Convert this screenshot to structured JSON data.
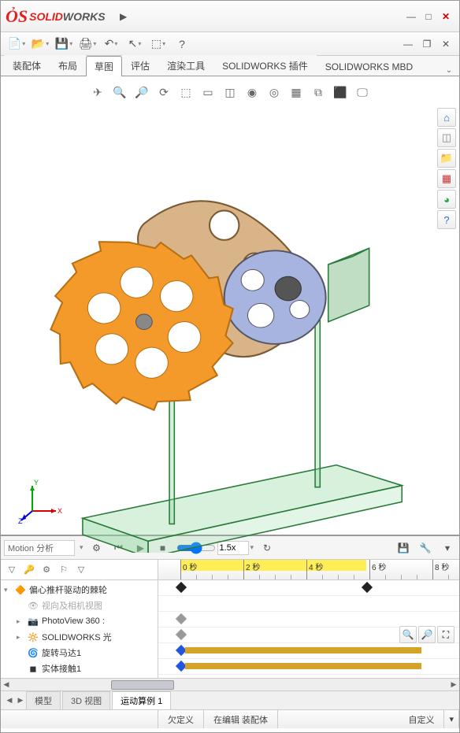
{
  "app": {
    "logo_solid": "SOLID",
    "logo_works": "WORKS"
  },
  "titlebar_tools": [
    "▶"
  ],
  "window_controls": {
    "min": "—",
    "max": "□",
    "close": "✕"
  },
  "ribbon": {
    "tabs": [
      "装配体",
      "布局",
      "草图",
      "评估",
      "渲染工具",
      "SOLIDWORKS 插件",
      "SOLIDWORKS MBD"
    ],
    "active_index": 2
  },
  "headsup_icons": [
    "✈",
    "🔍",
    "🔎",
    "⟳",
    "⬚",
    "▭",
    "◫",
    "◉",
    "◎",
    "▦",
    "⧉",
    "⬛",
    "🖵"
  ],
  "right_rail": [
    {
      "name": "home-icon",
      "glyph": "⌂",
      "color": "#2a6bcc"
    },
    {
      "name": "view-icon",
      "glyph": "◫",
      "color": "#888"
    },
    {
      "name": "folder-icon",
      "glyph": "📁",
      "color": "#caa12a"
    },
    {
      "name": "grid-icon",
      "glyph": "▦",
      "color": "#cc3333"
    },
    {
      "name": "palette-icon",
      "glyph": "◕",
      "color": "#22aa44"
    },
    {
      "name": "help-icon",
      "glyph": "?",
      "color": "#2a6bcc"
    }
  ],
  "triad": {
    "x": "X",
    "y": "Y",
    "z": "Z"
  },
  "motion": {
    "selector": "Motion 分析",
    "speed": "1.5x",
    "tree_header_icons": [
      "▽",
      "🔑",
      "⚙",
      "⚐",
      "▽"
    ],
    "tree": [
      {
        "exp": "▾",
        "ico": "🔶",
        "name": "assembly-root",
        "label": "偏心推杆驱动的棘轮",
        "disabled": false,
        "indent": 0
      },
      {
        "exp": "",
        "ico": "👁",
        "name": "view-camera",
        "label": "视向及相机视图",
        "disabled": true,
        "indent": 1
      },
      {
        "exp": "▸",
        "ico": "📷",
        "name": "photoview",
        "label": "PhotoView 360 :",
        "disabled": false,
        "indent": 1
      },
      {
        "exp": "▸",
        "ico": "🔆",
        "name": "sw-lights",
        "label": "SOLIDWORKS 光",
        "disabled": false,
        "indent": 1
      },
      {
        "exp": "",
        "ico": "🌀",
        "name": "rotary-motor",
        "label": "旋转马达1",
        "disabled": false,
        "indent": 1
      },
      {
        "exp": "",
        "ico": "◼",
        "name": "solid-contact",
        "label": "实体接触1",
        "disabled": false,
        "indent": 1
      }
    ],
    "timeline": {
      "ticks": [
        {
          "pos": 28,
          "label": "0 秒",
          "sub": false
        },
        {
          "pos": 108,
          "label": "2 秒",
          "sub": false
        },
        {
          "pos": 188,
          "label": "4 秒",
          "sub": false
        },
        {
          "pos": 268,
          "label": "6 秒",
          "sub": false
        },
        {
          "pos": 348,
          "label": "8 秒",
          "sub": false
        }
      ]
    },
    "tabs": [
      {
        "label": "模型",
        "active": false
      },
      {
        "label": "3D 视图",
        "active": false
      },
      {
        "label": "运动算例 1",
        "active": true
      }
    ]
  },
  "status": {
    "left_blank": "",
    "underdefined": "欠定义",
    "editing": "在编辑 装配体",
    "custom": "自定义"
  }
}
